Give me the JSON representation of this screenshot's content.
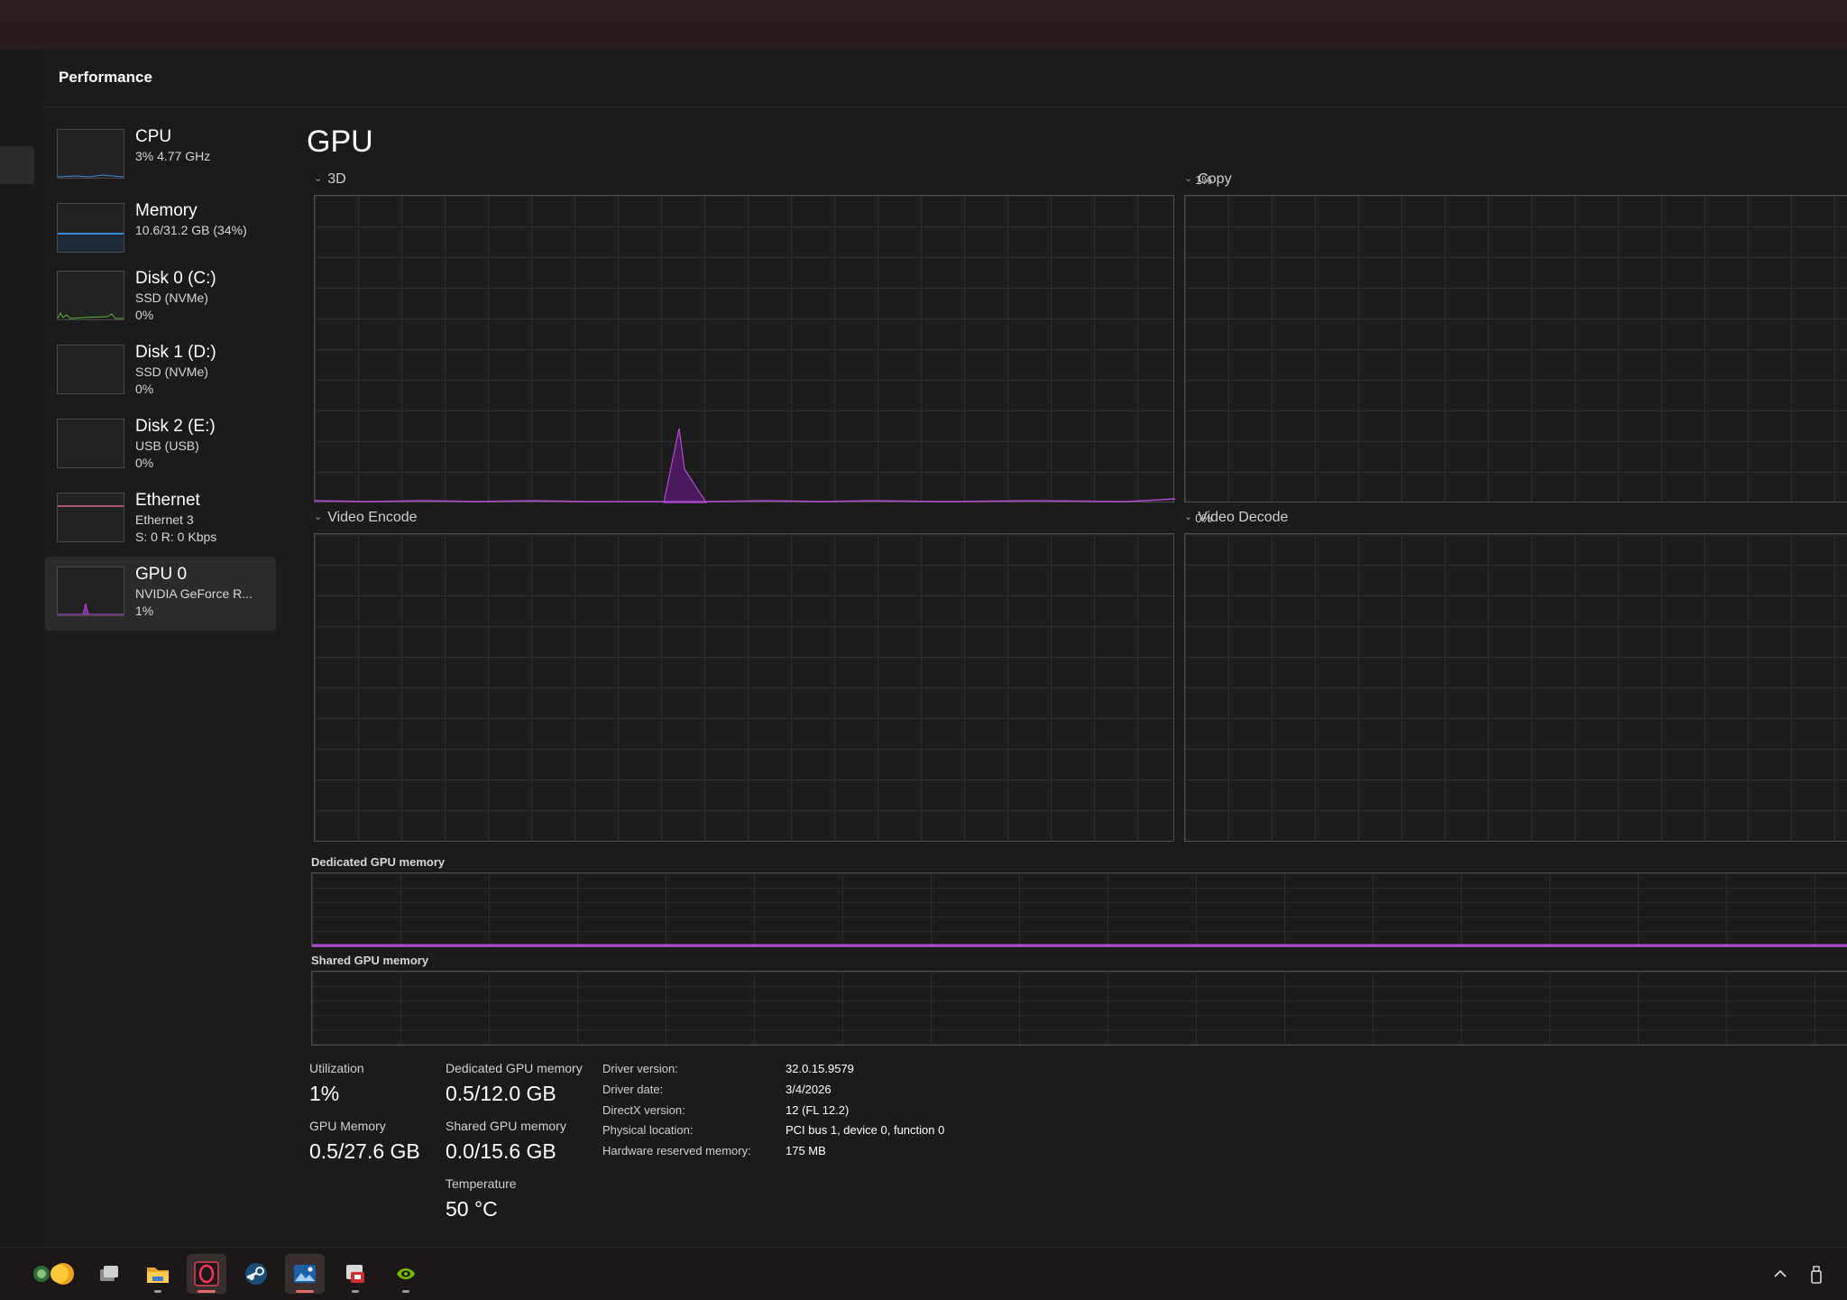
{
  "window": {
    "title": "Performance"
  },
  "nav": {
    "items": [
      {
        "name": "CPU",
        "line2": "3% 4.77 GHz",
        "line3": ""
      },
      {
        "name": "Memory",
        "line2": "10.6/31.2 GB (34%)",
        "line3": ""
      },
      {
        "name": "Disk 0 (C:)",
        "line2": "SSD (NVMe)",
        "line3": "0%"
      },
      {
        "name": "Disk 1 (D:)",
        "line2": "SSD (NVMe)",
        "line3": "0%"
      },
      {
        "name": "Disk 2 (E:)",
        "line2": "USB (USB)",
        "line3": "0%"
      },
      {
        "name": "Ethernet",
        "line2": "Ethernet 3",
        "line3": "S: 0 R: 0 Kbps"
      },
      {
        "name": "GPU 0",
        "line2": "NVIDIA GeForce R...",
        "line3": "1%"
      }
    ],
    "selected_index": 6
  },
  "main": {
    "title": "GPU",
    "graphs": {
      "g3d": {
        "label": "3D",
        "pct": "1%"
      },
      "copy": {
        "label": "Copy"
      },
      "video_encode": {
        "label": "Video Encode",
        "pct": "0%"
      },
      "video_decode": {
        "label": "Video Decode"
      }
    },
    "dedicated_mem_label": "Dedicated GPU memory",
    "shared_mem_label": "Shared GPU memory"
  },
  "stats": {
    "utilization_label": "Utilization",
    "utilization_value": "1%",
    "gpu_memory_label": "GPU Memory",
    "gpu_memory_value": "0.5/27.6 GB",
    "dedicated_label": "Dedicated GPU memory",
    "dedicated_value": "0.5/12.0 GB",
    "shared_label": "Shared GPU memory",
    "shared_value": "0.0/15.6 GB",
    "temperature_label": "Temperature",
    "temperature_value": "50 °C"
  },
  "info": [
    {
      "key": "Driver version:",
      "value": "32.0.15.9579"
    },
    {
      "key": "Driver date:",
      "value": "3/4/2026"
    },
    {
      "key": "DirectX version:",
      "value": "12 (FL 12.2)"
    },
    {
      "key": "Physical location:",
      "value": "PCI bus 1, device 0, function 0"
    },
    {
      "key": "Hardware reserved memory:",
      "value": "175 MB"
    }
  ],
  "colors": {
    "gpu": "#b04bd0",
    "memory": "#3b8ad8",
    "disk": "#5cb838",
    "ethernet": "#d86a8c",
    "cpu": "#3b8ad8"
  },
  "taskbar": {
    "apps": [
      "widgets-icon",
      "task-view-icon",
      "file-explorer-icon",
      "opera-gx-icon",
      "steam-icon",
      "photos-icon",
      "store-icon",
      "nvidia-icon"
    ],
    "tray": [
      "chevron-up-icon",
      "usb-drive-icon"
    ]
  }
}
